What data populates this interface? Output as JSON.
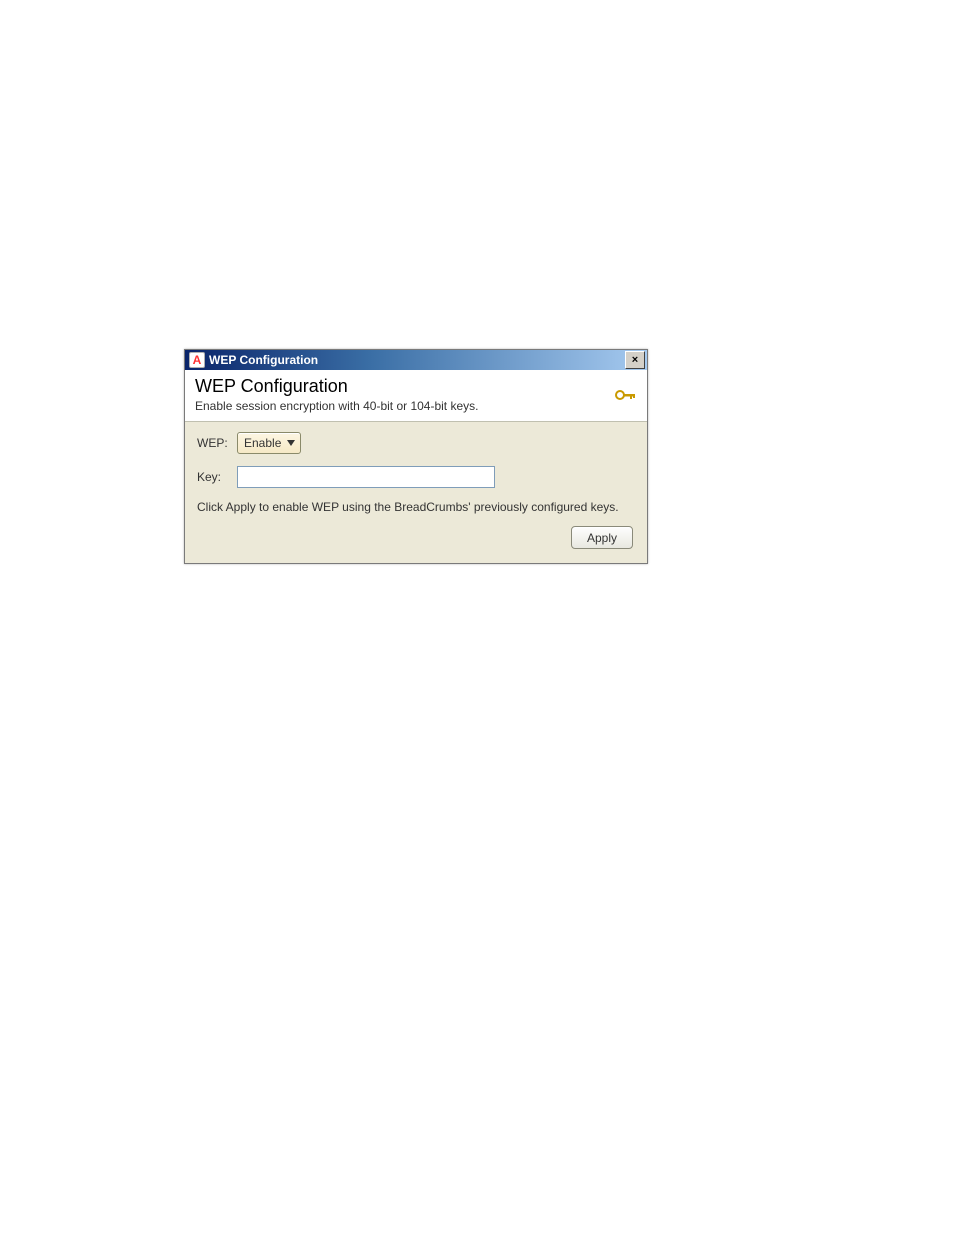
{
  "window": {
    "title": "WEP Configuration",
    "app_icon_letter": "A",
    "close_glyph": "×"
  },
  "header": {
    "title": "WEP Configuration",
    "subtitle": "Enable session encryption with 40-bit or 104-bit keys."
  },
  "form": {
    "wep_label": "WEP:",
    "wep_value": "Enable",
    "key_label": "Key:",
    "key_value": ""
  },
  "help_text": "Click Apply to enable WEP using the BreadCrumbs' previously configured keys.",
  "buttons": {
    "apply": "Apply"
  }
}
